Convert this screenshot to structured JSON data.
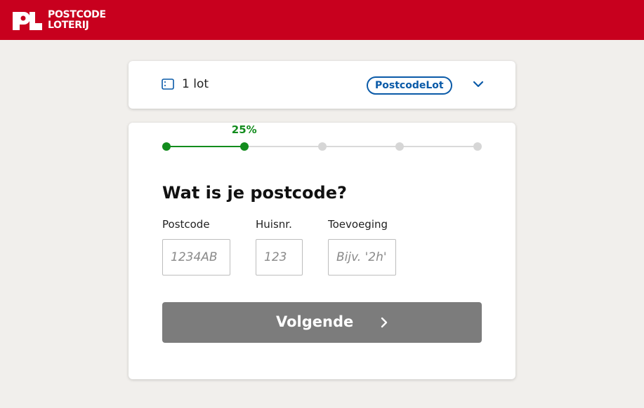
{
  "header": {
    "brand_line1": "POSTCODE",
    "brand_line2": "LOTERIJ",
    "logo_icon": "pl-logo-icon",
    "background_color": "#c8001e"
  },
  "summary": {
    "ticket_icon": "ticket-icon",
    "lot_label": "1 lot",
    "product_badge": "PostcodeLot",
    "expand_icon": "chevron-down-icon",
    "accent_color": "#0a5aa8"
  },
  "form": {
    "progress": {
      "percent_label": "25%",
      "value": 0.25,
      "steps_total": 5,
      "steps_completed": 2,
      "color": "#128c1d"
    },
    "question": "Wat is je postcode?",
    "fields": {
      "postcode": {
        "label": "Postcode",
        "placeholder": "1234AB",
        "value": ""
      },
      "huisnummer": {
        "label": "Huisnr.",
        "placeholder": "123",
        "value": ""
      },
      "toevoeging": {
        "label": "Toevoeging",
        "placeholder": "Bijv. '2h'",
        "value": ""
      }
    },
    "next_button": {
      "label": "Volgende",
      "icon": "chevron-right-icon",
      "color": "#7c7c7c"
    }
  }
}
